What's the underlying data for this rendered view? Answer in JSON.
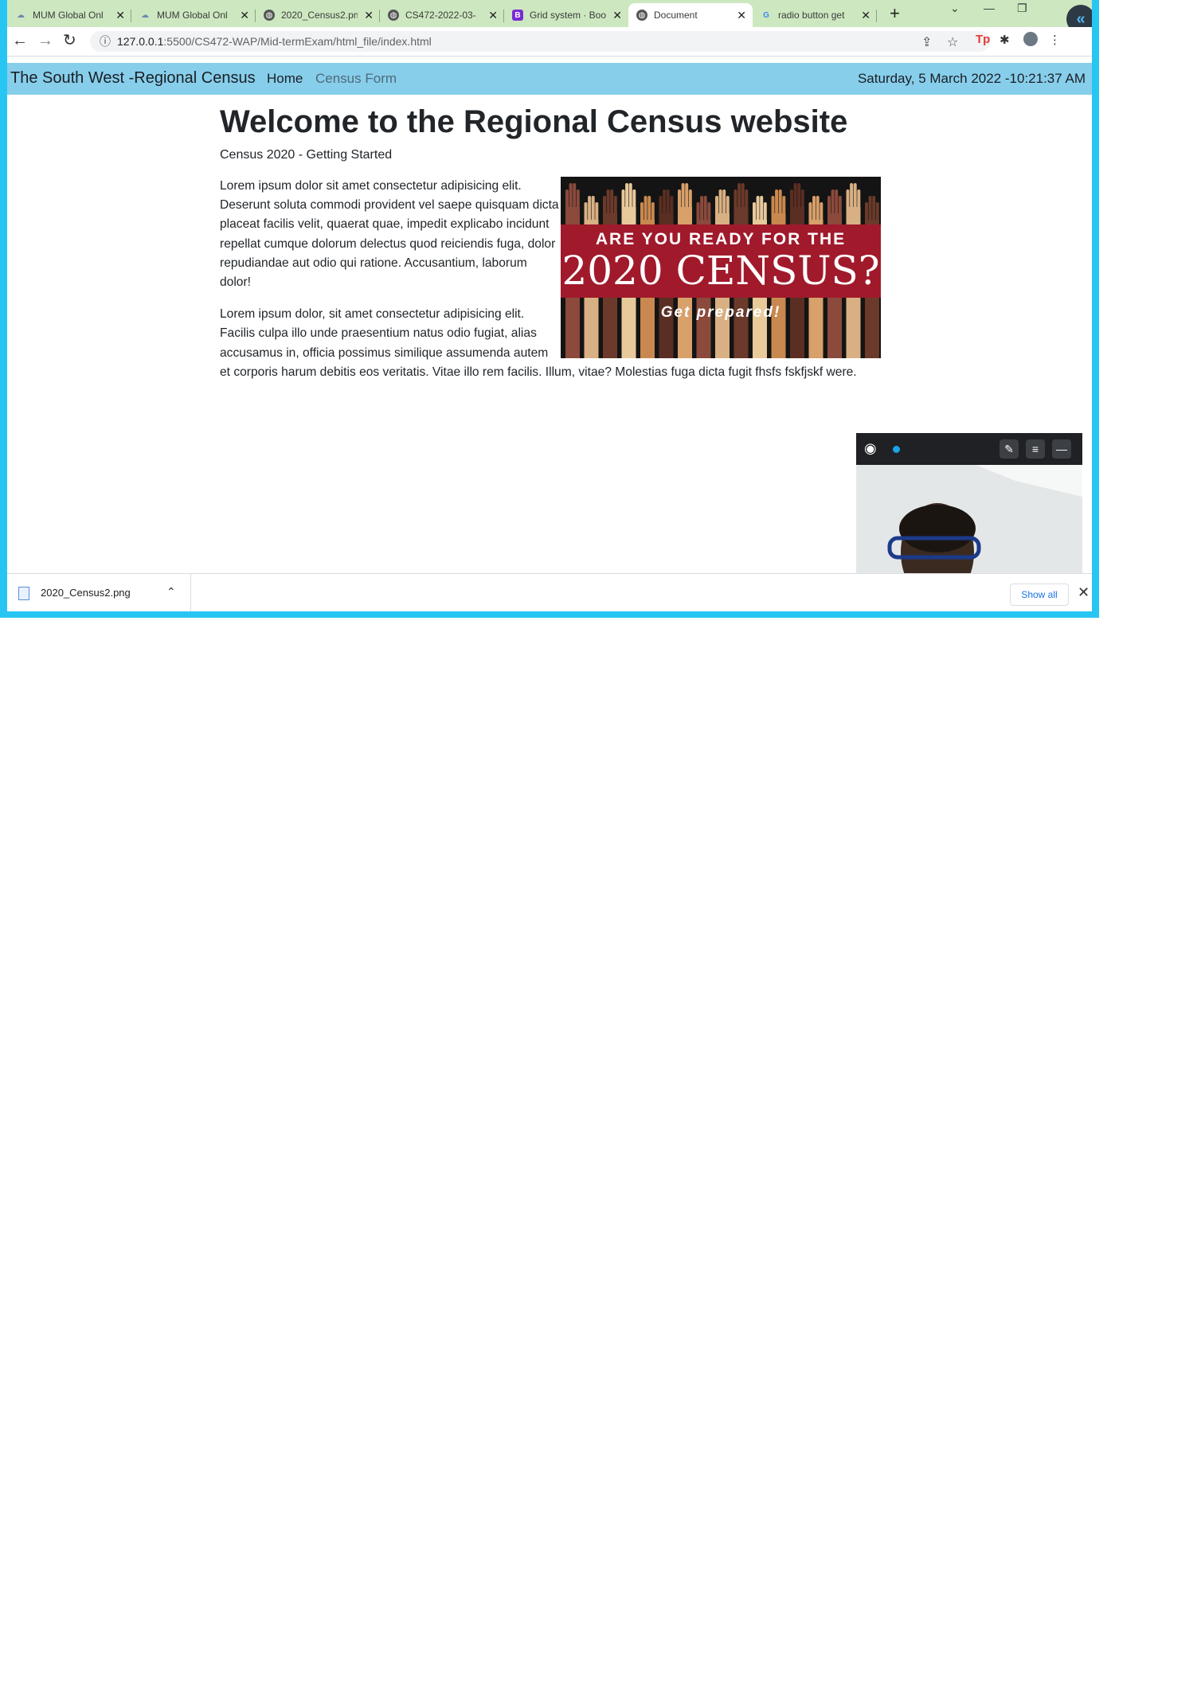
{
  "browser": {
    "tabs": [
      {
        "title": "MUM Global Onl"
      },
      {
        "title": "MUM Global Onl"
      },
      {
        "title": "2020_Census2.pn"
      },
      {
        "title": "CS472-2022-03-"
      },
      {
        "title": "Grid system · Boo"
      },
      {
        "title": "Document"
      },
      {
        "title": "radio button get"
      }
    ],
    "active_tab_index": 5,
    "new_tab_label": "+",
    "url_host": "127.0.0.1",
    "url_rest": ":5500/CS472-WAP/Mid-termExam/html_file/index.html"
  },
  "site": {
    "brand": "The South West -Regional Census",
    "nav": {
      "home": "Home",
      "census_form": "Census Form"
    },
    "datetime": "Saturday, 5 March 2022 -10:21:37 AM"
  },
  "main": {
    "heading": "Welcome to the Regional Census website",
    "subheading": "Census 2020 - Getting Started",
    "paragraph1": "Lorem ipsum dolor sit amet consectetur adipisicing elit. Deserunt soluta commodi provident vel saepe quisquam dicta placeat facilis velit, quaerat quae, impedit explicabo incidunt repellat cumque dolorum delectus quod reiciendis fuga, dolor repudiandae aut odio qui ratione. Accusantium, laborum dolor!",
    "paragraph2": "Lorem ipsum dolor, sit amet consectetur adipisicing elit. Facilis culpa illo unde praesentium natus odio fugiat, alias accusamus in, officia possimus similique assumenda autem et corporis harum debitis eos veritatis. Vitae illo rem facilis. Illum, vitae? Molestias fuga dicta fugit fhsfs fskfjskf were.",
    "banner": {
      "line1": "ARE YOU READY FOR THE",
      "line2": "2020 CENSUS?",
      "line3": "Get prepared!",
      "colors": {
        "band": "#a01a2b",
        "background": "#141414",
        "hands": [
          "#8b4a3c",
          "#d9b083",
          "#6b3a2a",
          "#e8c99a",
          "#c9884f",
          "#5a2e22",
          "#d8a06a"
        ]
      }
    }
  },
  "downloads": {
    "filename": "2020_Census2.png",
    "show_all": "Show all"
  },
  "colors": {
    "navbar": "#87ceeb",
    "tabstrip": "#cde8c0",
    "capture_border": "#27c6f2"
  }
}
